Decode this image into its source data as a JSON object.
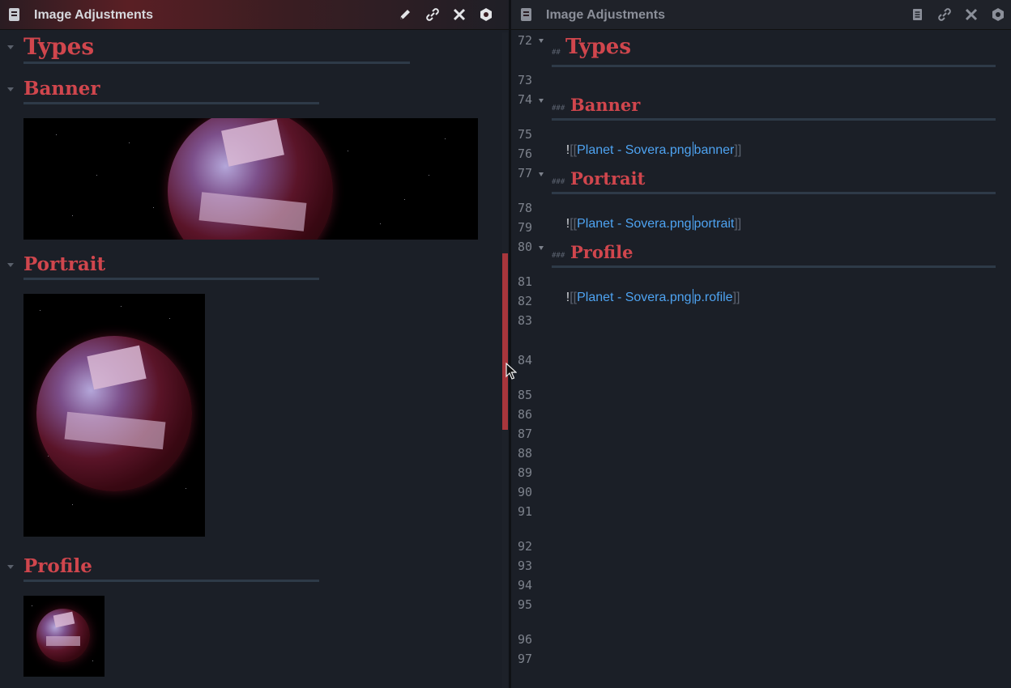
{
  "left_pane": {
    "title": "Image Adjustments",
    "toolbar_icons": [
      "edit-icon",
      "link-icon",
      "close-icon",
      "settings-icon"
    ],
    "headings": {
      "types": "Types",
      "banner": "Banner",
      "portrait": "Portrait",
      "profile": "Profile"
    }
  },
  "right_pane": {
    "title": "Image Adjustments",
    "toolbar_icons": [
      "document-icon",
      "link-icon",
      "close-icon",
      "settings-icon"
    ],
    "line_numbers": [
      "72",
      "73",
      "74",
      "75",
      "76",
      "77",
      "78",
      "79",
      "80",
      "81",
      "82",
      "83",
      "84",
      "85",
      "86",
      "87",
      "88",
      "89",
      "90",
      "91",
      "92",
      "93",
      "94",
      "95",
      "96",
      "97"
    ],
    "h2_marker": "##",
    "h3_marker": "###",
    "headings": {
      "types": "Types",
      "banner": "Banner",
      "portrait": "Portrait",
      "profile": "Profile"
    },
    "embeds": {
      "bang": "!",
      "open": "[[",
      "close": "]]",
      "file": "Planet - Sovera.png",
      "banner_opt": "banner",
      "portrait_opt": "portrait",
      "profile_opt": "p.rofile"
    }
  },
  "colors": {
    "heading": "#d0464d",
    "link": "#4ea3f1",
    "scroll_thumb": "#a8363c",
    "background": "#1b1f27"
  }
}
